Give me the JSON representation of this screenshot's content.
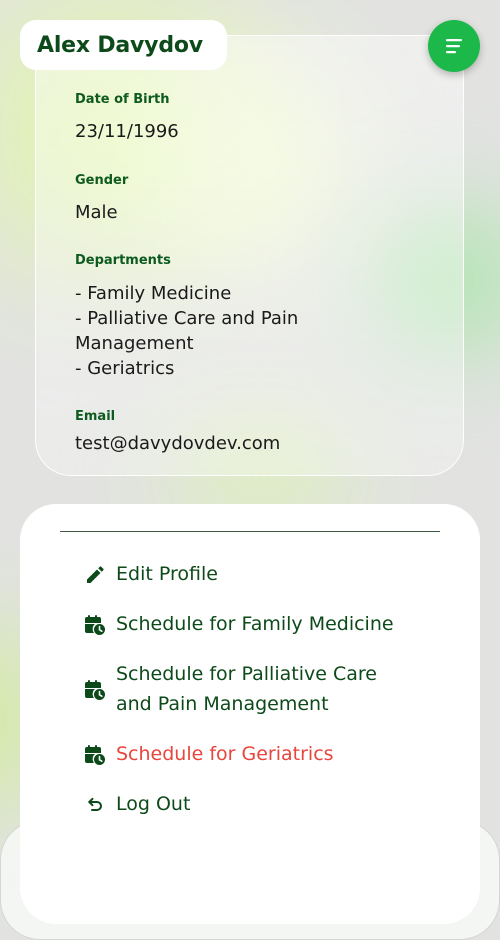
{
  "profile": {
    "name": "Alex Davydov"
  },
  "fields": {
    "dob": {
      "label": "Date of Birth",
      "value": "23/11/1996"
    },
    "gender": {
      "label": "Gender",
      "value": "Male"
    },
    "departments": {
      "label": "Departments",
      "items": [
        "- Family Medicine",
        "- Palliative Care and Pain",
        "Management",
        "- Geriatrics"
      ]
    },
    "email": {
      "label": "Email",
      "value": "test@davydovdev.com"
    }
  },
  "actions": {
    "edit_profile": {
      "label": "Edit Profile",
      "icon": "pencil-icon"
    },
    "schedule_family": {
      "label": "Schedule for Family Medicine",
      "icon": "calendar-clock-icon"
    },
    "schedule_palliative": {
      "line1": "Schedule for Palliative Care",
      "line2": "and Pain Management",
      "icon": "calendar-clock-icon"
    },
    "schedule_geriatrics": {
      "label": "Schedule for Geriatrics",
      "icon": "calendar-clock-icon"
    },
    "log_out": {
      "label": "Log Out",
      "icon": "undo-arrow-icon"
    }
  },
  "colors": {
    "primary_dark_green": "#0d4a1a",
    "accent_green": "#1db84a",
    "danger_red": "#e8453c"
  }
}
